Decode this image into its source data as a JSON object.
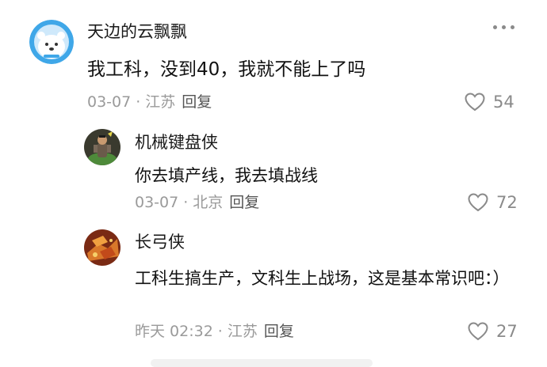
{
  "comments": [
    {
      "user": "天边的云飘飘",
      "content": "我工科，没到40，我就不能上了吗",
      "date": "03-07",
      "location": "江苏",
      "reply_label": "回复",
      "likes": "54",
      "avatar_icon": "polar-bear-avatar"
    },
    {
      "user": "机械键盘侠",
      "content": "你去填产线，我去填战线",
      "date": "03-07",
      "location": "北京",
      "reply_label": "回复",
      "likes": "72",
      "avatar_icon": "game-character-avatar"
    },
    {
      "user": "长弓侠",
      "content": "工科生搞生产，文科生上战场，这是基本常识吧：）",
      "date": "昨天 02:32",
      "location": "江苏",
      "reply_label": "回复",
      "likes": "27",
      "avatar_icon": "food-photo-avatar"
    }
  ],
  "separator": "·",
  "colors": {
    "meta": "#9a9a9a",
    "like_icon": "#8a8a8a",
    "avatar_blue": "#3fa7e8"
  }
}
